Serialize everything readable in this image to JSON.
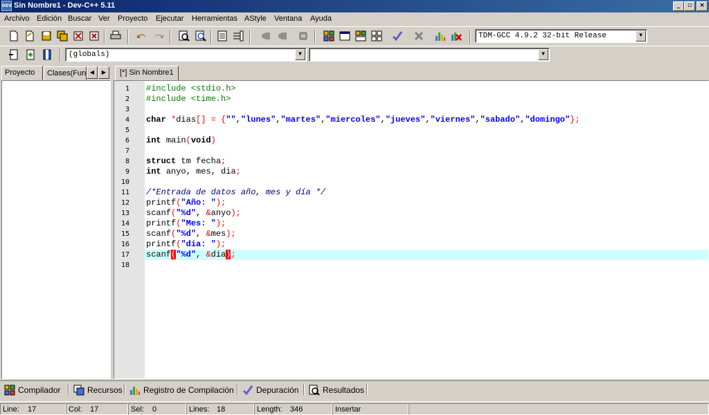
{
  "window": {
    "title": "Sin Nombre1 - Dev-C++ 5.11",
    "icon_text": "DEV",
    "minimize": "_",
    "maximize": "▫",
    "close": "×"
  },
  "menu": [
    "Archivo",
    "Edición",
    "Buscar",
    "Ver",
    "Proyecto",
    "Ejecutar",
    "Herramientas",
    "AStyle",
    "Ventana",
    "Ayuda"
  ],
  "toolbar": {
    "compiler_select": "TDM-GCC 4.9.2 32-bit Release",
    "scope_select": "(globals)",
    "function_select": ""
  },
  "left_panel": {
    "tabs": [
      "Proyecto",
      "Clases(Fun"
    ]
  },
  "editor": {
    "tab_label": "[*] Sin Nombre1",
    "current_line": 17,
    "line_numbers": [
      "1",
      "2",
      "3",
      "4",
      "5",
      "6",
      "7",
      "8",
      "9",
      "10",
      "11",
      "12",
      "13",
      "14",
      "15",
      "16",
      "17",
      "18"
    ],
    "lines": [
      "#include <stdio.h>",
      "#include <time.h>",
      "",
      "char *dias[] = {\"\",\"lunes\",\"martes\",\"miercoles\",\"jueves\",\"viernes\",\"sabado\",\"domingo\"};",
      "",
      "int main(void)",
      "",
      "struct tm fecha;",
      "int anyo, mes, dia;",
      "",
      "/*Entrada de datos año, mes y día */",
      "printf(\"Año: \");",
      "scanf(\"%d\", &anyo);",
      "printf(\"Mes: \");",
      "scanf(\"%d\", &mes);",
      "printf(\"dia: \");",
      "scanf(\"%d\", &dia);",
      ""
    ]
  },
  "bottom_tabs": [
    {
      "label": "Compilador",
      "icon": "compiler-grid-icon"
    },
    {
      "label": "Recursos",
      "icon": "resources-icon"
    },
    {
      "label": "Registro de Compilación",
      "icon": "compile-log-chart-icon"
    },
    {
      "label": "Depuración",
      "icon": "debug-check-icon"
    },
    {
      "label": "Resultados",
      "icon": "results-search-icon"
    }
  ],
  "status": {
    "line_label": "Line:",
    "line_value": "17",
    "col_label": "Col:",
    "col_value": "17",
    "sel_label": "Sel:",
    "sel_value": "0",
    "lines_label": "Lines:",
    "lines_value": "18",
    "length_label": "Length:",
    "length_value": "346",
    "mode": "Insertar"
  },
  "colors": {
    "titlebar_start": "#0a246a",
    "titlebar_end": "#3a6ea5",
    "current_line": "#ccffff",
    "gutter": "#e4e4e4"
  }
}
